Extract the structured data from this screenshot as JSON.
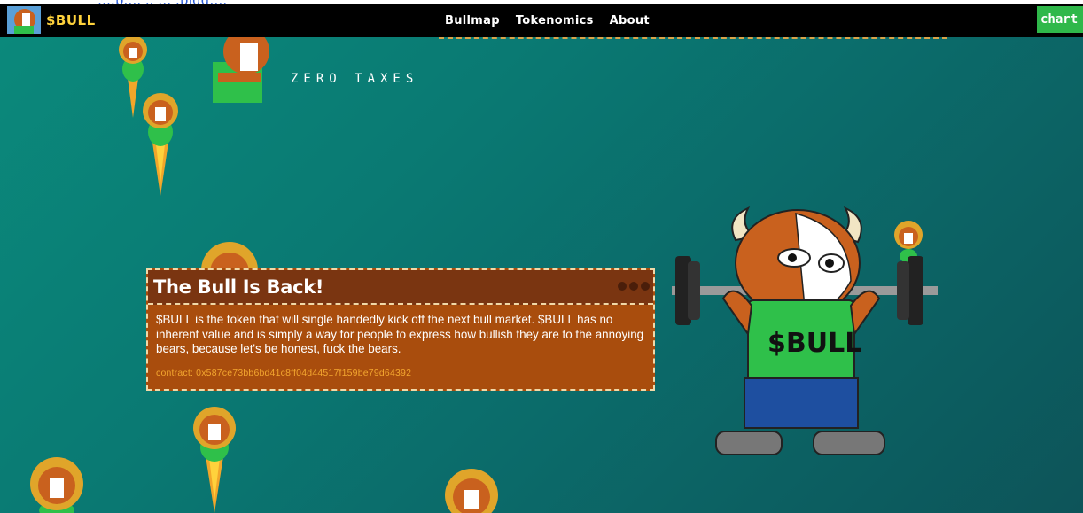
{
  "browser_strip": {
    "text": "….p….  .. … .bigg…."
  },
  "nav": {
    "logo_text": "$BULL",
    "links": [
      "Bullmap",
      "Tokenomics",
      "About"
    ],
    "chart_label": "chart"
  },
  "hero": {
    "zero_taxes": "ZERO TAXES",
    "shirt_text": "$BULL"
  },
  "card": {
    "title": "The Bull Is Back!",
    "body": "$BULL is the token that will single handedly kick off the next bull market. $BULL has no inherent value and is simply a way for people to express how bullish they are to the annoying bears, because let's be honest, fuck the bears.",
    "contract": "contract: 0x587ce73bb6bd41c8ff04d44517f159be79d64392"
  },
  "colors": {
    "nav_bg": "#000000",
    "logo": "#ffd23c",
    "chart_button": "#2fb84a",
    "card_bg": "#a94d0d",
    "card_header": "#7a3511",
    "contract_text": "#f3a62f"
  }
}
